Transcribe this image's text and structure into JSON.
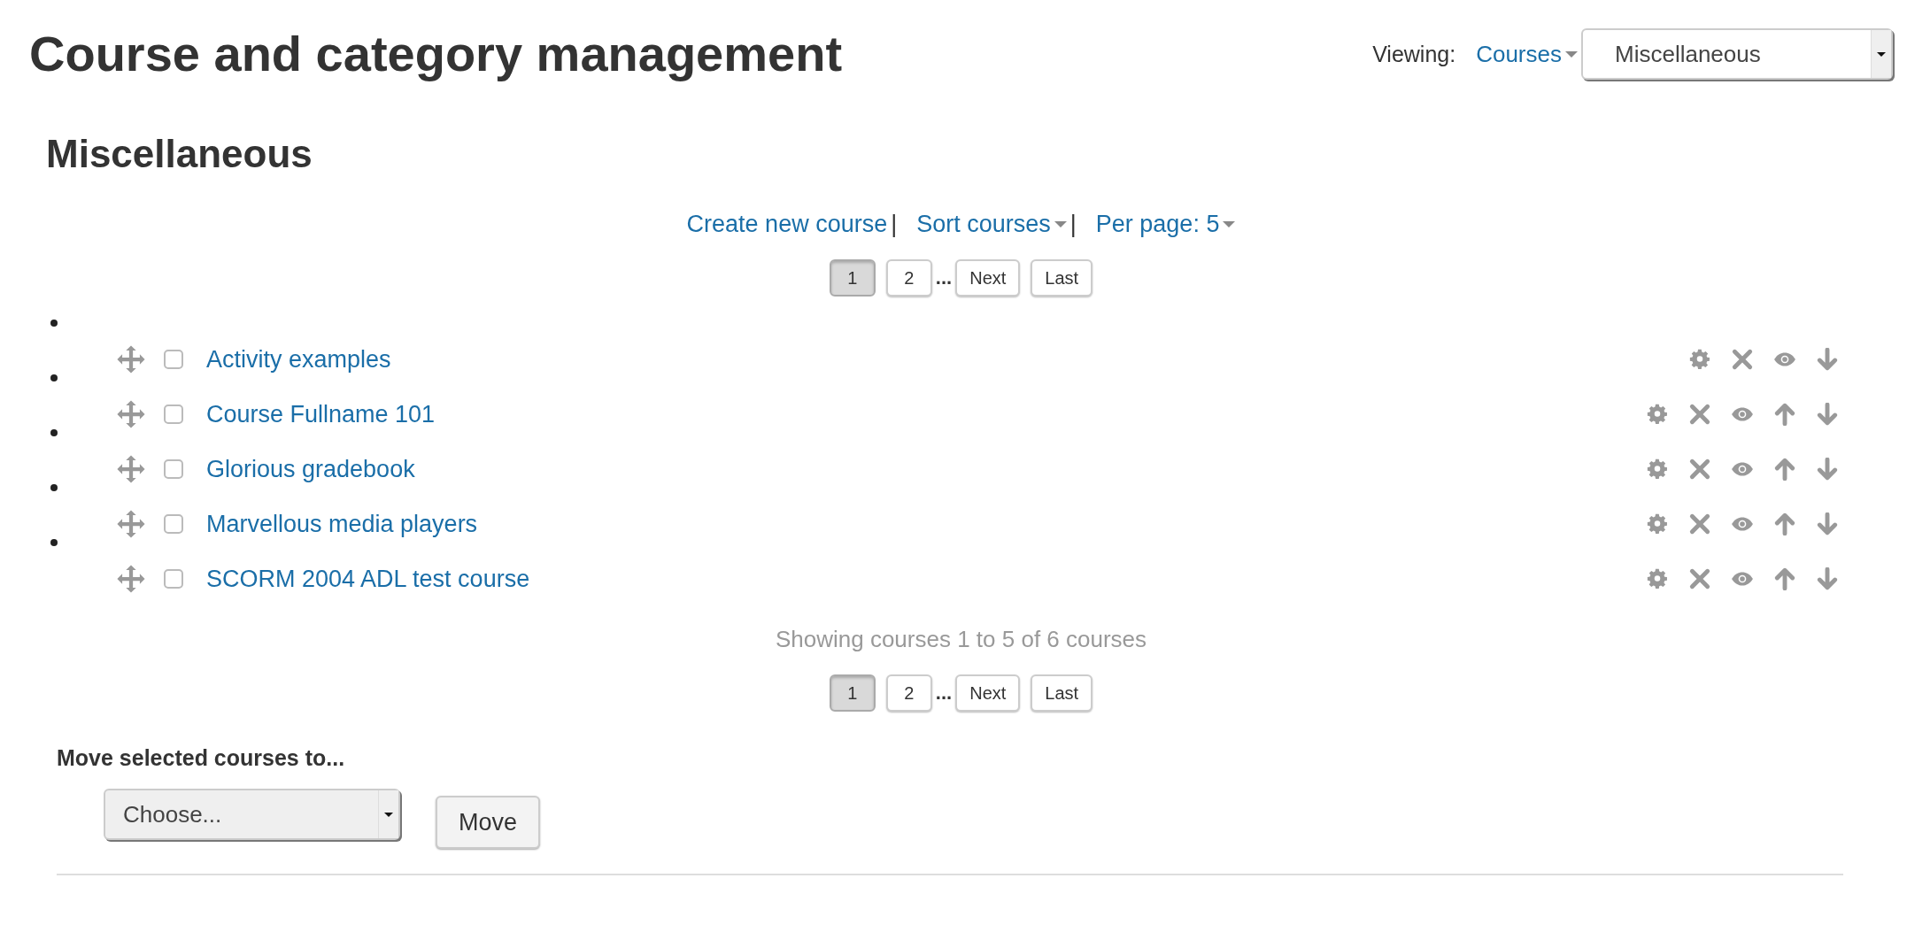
{
  "header": {
    "title": "Course and category management",
    "viewing_label": "Viewing:",
    "view_mode": "Courses",
    "category_select": "Miscellaneous"
  },
  "category_title": "Miscellaneous",
  "actions": [
    {
      "label": "Create new course",
      "dropdown": false,
      "separator": "|"
    },
    {
      "label": "Sort courses",
      "dropdown": true,
      "separator": "|"
    },
    {
      "label": "Per page: 5",
      "dropdown": true
    }
  ],
  "pagination_top": [
    {
      "kind": "page",
      "label": "1",
      "selected": true
    },
    {
      "kind": "page",
      "label": "2",
      "selected": false
    },
    {
      "kind": "ellipsis",
      "label": "..."
    },
    {
      "kind": "page",
      "label": "Next",
      "selected": false
    },
    {
      "kind": "page",
      "label": "Last",
      "selected": false
    }
  ],
  "courses": [
    {
      "name": "Activity examples",
      "checked": false,
      "move_up": false
    },
    {
      "name": "Course Fullname 101",
      "checked": false,
      "move_up": true
    },
    {
      "name": "Glorious gradebook",
      "checked": false,
      "move_up": true
    },
    {
      "name": "Marvellous media players",
      "checked": false,
      "move_up": true
    },
    {
      "name": "SCORM 2004 ADL test course",
      "checked": false,
      "move_up": true
    }
  ],
  "summary": "Showing courses 1 to 5 of 6 courses",
  "pagination_bottom": [
    {
      "kind": "page",
      "label": "1",
      "selected": true
    },
    {
      "kind": "page",
      "label": "2",
      "selected": false
    },
    {
      "kind": "ellipsis",
      "label": "..."
    },
    {
      "kind": "page",
      "label": "Next",
      "selected": false
    },
    {
      "kind": "page",
      "label": "Last",
      "selected": false
    }
  ],
  "move": {
    "label": "Move selected courses to...",
    "select": "Choose...",
    "button": "Move"
  }
}
